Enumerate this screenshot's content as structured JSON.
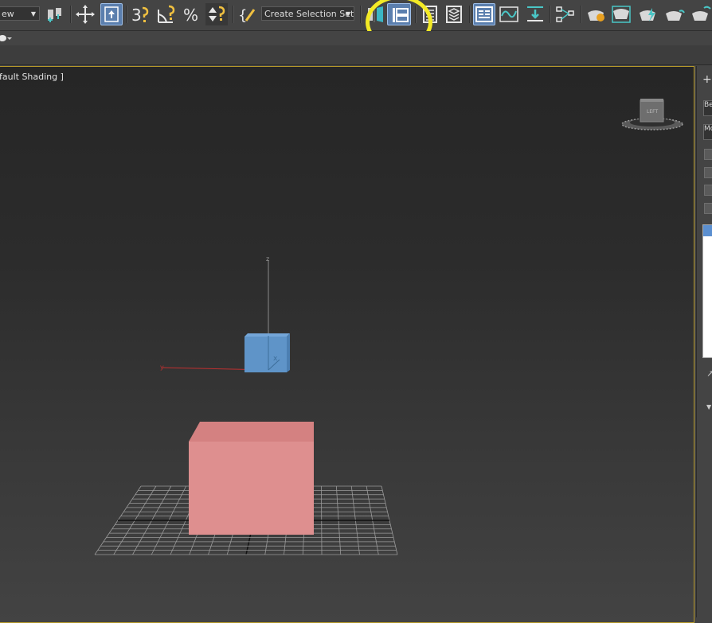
{
  "toolbar": {
    "view_combo": "ew",
    "selection_set_combo": "Create Selection Set",
    "buttons": [
      {
        "name": "select-and-link-icon"
      },
      {
        "name": "select-and-move-icon"
      },
      {
        "name": "use-pivot-point-center-icon"
      },
      {
        "name": "3d-snaps-toggle-icon",
        "label": "3"
      },
      {
        "name": "angle-snap-toggle-icon"
      },
      {
        "name": "percent-snap-toggle-icon",
        "label": "%"
      },
      {
        "name": "spinner-snap-toggle-icon"
      },
      {
        "name": "edit-named-selection-sets-icon"
      },
      {
        "name": "mirror-icon"
      },
      {
        "name": "align-icon"
      },
      {
        "name": "toggle-scene-explorer-icon"
      },
      {
        "name": "toggle-layer-explorer-icon"
      },
      {
        "name": "toggle-ribbon-icon"
      },
      {
        "name": "curve-editor-icon"
      },
      {
        "name": "schematic-view-icon"
      },
      {
        "name": "material-editor-icon"
      },
      {
        "name": "render-setup-icon"
      },
      {
        "name": "rendered-frame-window-icon"
      },
      {
        "name": "render-production-icon"
      },
      {
        "name": "render-in-cloud-icon"
      }
    ]
  },
  "viewport": {
    "label": "fault Shading ]",
    "viewcube_face": "LEFT",
    "axes": {
      "z": "z",
      "x": "x",
      "y": "y"
    },
    "colors": {
      "small_box": "#5f94c8",
      "large_box": "#de8f8f",
      "border": "#b79a2a",
      "highlight": "#f3ea25"
    }
  }
}
